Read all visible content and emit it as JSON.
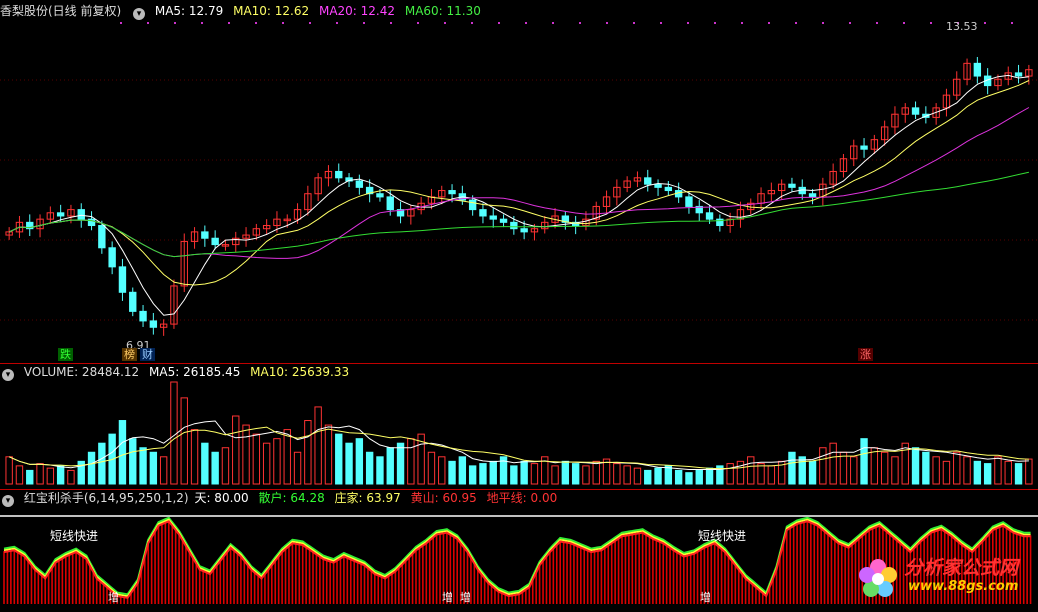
{
  "main": {
    "title": "香梨股份(日线 前复权)",
    "ma": [
      {
        "label": "MA5: 12.79",
        "color": "#ffffff"
      },
      {
        "label": "MA10: 12.62",
        "color": "#ffff66"
      },
      {
        "label": "MA20: 12.42",
        "color": "#ff44ff"
      },
      {
        "label": "MA60: 11.30",
        "color": "#44ee44"
      }
    ],
    "high_label": "13.53",
    "low_label": "6.91",
    "markers": [
      {
        "text": "跌",
        "color": "#33ff33",
        "bg": "#006000"
      },
      {
        "text": "榜",
        "color": "#ffcc66",
        "bg": "#553300"
      },
      {
        "text": "财",
        "color": "#99ccff",
        "bg": "#002255"
      },
      {
        "text": "涨",
        "color": "#ff6666",
        "bg": "#550000"
      }
    ]
  },
  "volume": {
    "label": "VOLUME: 28484.12",
    "ma5": "MA5: 26185.45",
    "ma10": "MA10: 25639.33"
  },
  "indicator": {
    "title": "红宝利杀手(6,14,95,250,1,2)",
    "tian": "天: 80.00",
    "sanhu": "散户: 64.28",
    "zhuangjia": "庄家: 63.97",
    "huangshan": "黄山: 60.95",
    "dipingxian": "地平线: 0.00",
    "labels_short": [
      "短线快进",
      "短线快进"
    ],
    "labels_zeng": [
      "增",
      "增",
      "增",
      "增"
    ]
  },
  "watermark": {
    "name": "分析家公式网",
    "url": "www.88gs.com"
  },
  "colors": {
    "up": "#ff3333",
    "down": "#54ffff",
    "ma5": "#ffffff",
    "ma10": "#ffff66",
    "ma20": "#dd33dd",
    "ma60": "#33dd33"
  },
  "chart_data": {
    "type": "candlestick",
    "n": 100,
    "closes": [
      7.9,
      8.2,
      8.0,
      8.3,
      8.5,
      8.4,
      8.6,
      8.3,
      8.1,
      7.4,
      6.8,
      6.0,
      5.4,
      5.1,
      4.9,
      5.0,
      6.2,
      7.6,
      7.9,
      7.7,
      7.5,
      7.5,
      7.7,
      7.8,
      8.0,
      8.1,
      8.3,
      8.3,
      8.6,
      9.1,
      9.6,
      9.8,
      9.6,
      9.5,
      9.3,
      9.1,
      9.0,
      8.6,
      8.4,
      8.6,
      8.8,
      9.0,
      9.2,
      9.1,
      8.9,
      8.6,
      8.4,
      8.3,
      8.2,
      8.0,
      7.9,
      8.0,
      8.2,
      8.4,
      8.2,
      8.1,
      8.3,
      8.7,
      9.0,
      9.3,
      9.5,
      9.6,
      9.4,
      9.3,
      9.2,
      9.0,
      8.7,
      8.5,
      8.3,
      8.1,
      8.3,
      8.6,
      8.8,
      9.1,
      9.2,
      9.4,
      9.3,
      9.1,
      9.0,
      9.4,
      9.8,
      10.2,
      10.6,
      10.5,
      10.8,
      11.2,
      11.6,
      11.8,
      11.6,
      11.5,
      11.8,
      12.2,
      12.7,
      13.2,
      12.8,
      12.5,
      12.7,
      12.9,
      12.8,
      13.0
    ],
    "volumes": [
      12,
      8,
      6,
      9,
      7,
      8,
      6,
      10,
      14,
      18,
      22,
      28,
      20,
      16,
      14,
      12,
      45,
      38,
      24,
      18,
      14,
      16,
      30,
      26,
      22,
      18,
      20,
      24,
      14,
      28,
      34,
      26,
      22,
      18,
      20,
      14,
      12,
      16,
      18,
      20,
      22,
      14,
      12,
      10,
      12,
      8,
      9,
      10,
      12,
      8,
      10,
      9,
      12,
      8,
      10,
      9,
      8,
      10,
      11,
      9,
      8,
      7,
      6,
      7,
      8,
      6,
      5,
      6,
      7,
      8,
      9,
      10,
      12,
      9,
      8,
      10,
      14,
      12,
      10,
      16,
      18,
      14,
      12,
      20,
      16,
      14,
      12,
      18,
      16,
      14,
      12,
      10,
      14,
      12,
      10,
      9,
      12,
      10,
      9,
      11
    ],
    "indicator": [
      60,
      62,
      55,
      40,
      30,
      48,
      55,
      60,
      52,
      30,
      20,
      10,
      8,
      25,
      70,
      90,
      95,
      80,
      60,
      40,
      35,
      50,
      65,
      55,
      40,
      30,
      45,
      60,
      70,
      68,
      60,
      52,
      48,
      55,
      50,
      45,
      35,
      30,
      38,
      50,
      62,
      70,
      80,
      82,
      75,
      60,
      40,
      25,
      15,
      10,
      12,
      20,
      45,
      60,
      72,
      70,
      65,
      60,
      62,
      70,
      78,
      80,
      82,
      75,
      70,
      62,
      55,
      58,
      65,
      70,
      60,
      45,
      30,
      20,
      10,
      40,
      85,
      92,
      95,
      90,
      80,
      70,
      65,
      75,
      85,
      90,
      80,
      70,
      60,
      72,
      82,
      86,
      78,
      68,
      60,
      72,
      85,
      90,
      82,
      78
    ],
    "ylim": [
      4.5,
      14.5
    ]
  }
}
